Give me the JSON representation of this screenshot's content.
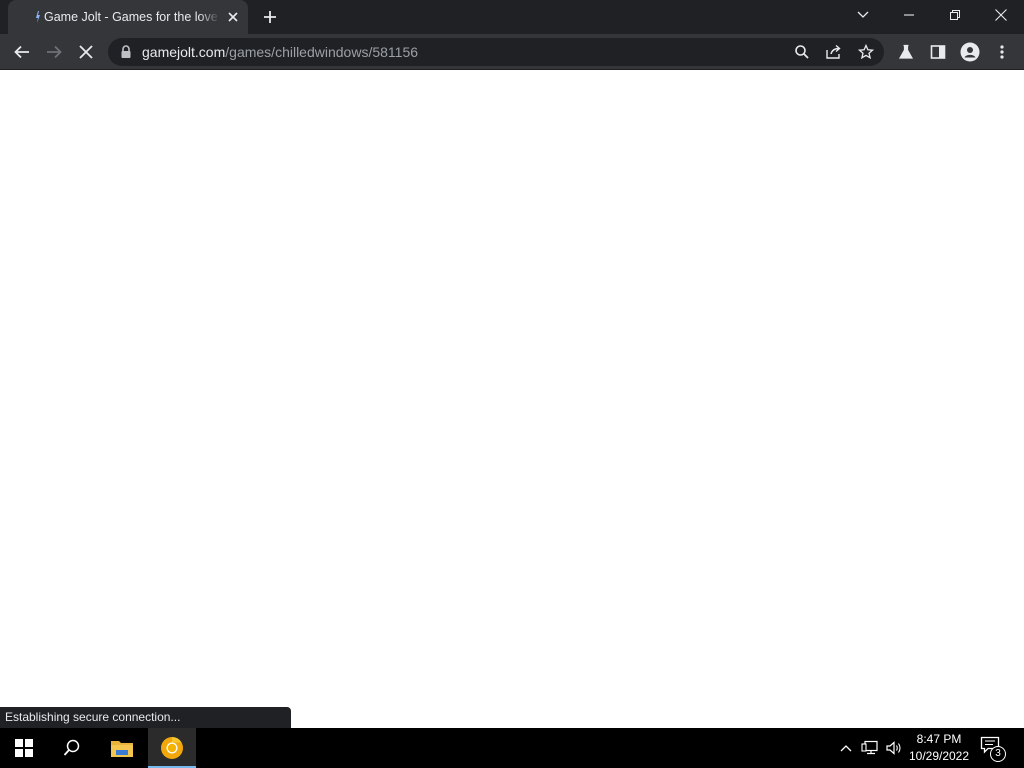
{
  "browser": {
    "tab": {
      "title": "Game Jolt - Games for the love of",
      "favicon": "game-jolt-favicon"
    },
    "address_bar": {
      "host": "gamejolt.com",
      "path": "/games/chilledwindows/581156"
    },
    "status_text": "Establishing secure connection..."
  },
  "taskbar": {
    "clock": {
      "time": "8:47 PM",
      "date": "10/29/2022"
    },
    "notification_count": "3",
    "pinned": [
      "start-icon",
      "search-icon",
      "file-explorer-icon",
      "chrome-canary-icon"
    ]
  },
  "colors": {
    "tab_strip": "#202124",
    "toolbar": "#35363a",
    "omnibox": "#202124",
    "taskbar": "#000000",
    "taskbar_active_underline": "#76b9ed",
    "page_background": "#ffffff"
  }
}
